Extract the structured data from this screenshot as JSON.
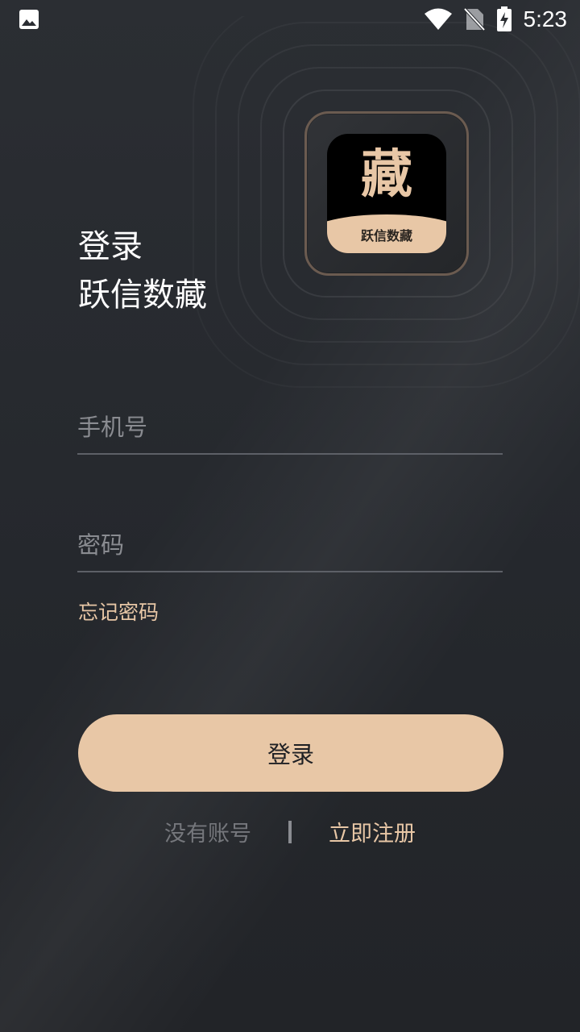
{
  "status_bar": {
    "time": "5:23",
    "icons": [
      "gallery-icon",
      "wifi-icon",
      "no-sim-icon",
      "battery-charging-icon"
    ]
  },
  "logo": {
    "glyph": "藏",
    "caption": "跃信数藏"
  },
  "heading": {
    "line1": "登录",
    "line2": "跃信数藏"
  },
  "form": {
    "phone": {
      "value": "",
      "placeholder": "手机号"
    },
    "password": {
      "value": "",
      "placeholder": "密码"
    },
    "forgot_label": "忘记密码",
    "login_label": "登录"
  },
  "footer": {
    "no_account": "没有账号",
    "register_label": "立即注册"
  },
  "colors": {
    "background": "#25282d",
    "accent": "#e8c7a6",
    "text_primary": "#ffffff",
    "text_muted": "#75777c"
  }
}
